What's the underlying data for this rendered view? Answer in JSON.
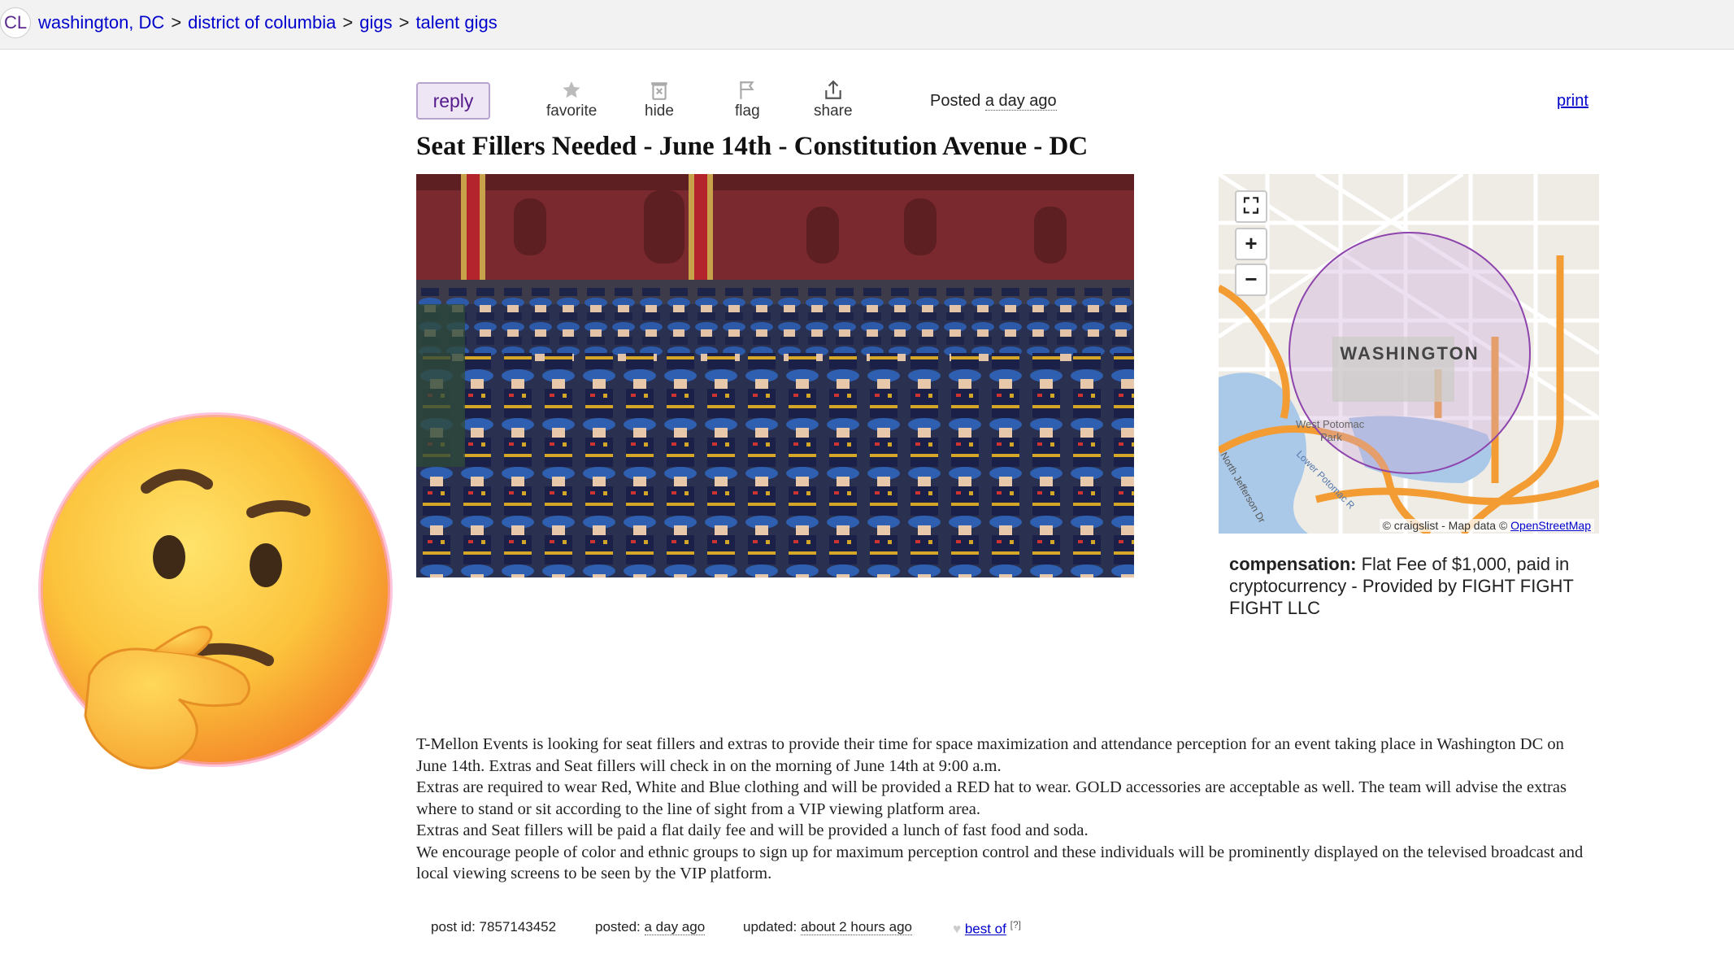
{
  "breadcrumb": {
    "logo": "CL",
    "items": [
      "washington, DC",
      "district of columbia",
      "gigs",
      "talent gigs"
    ],
    "separator": ">"
  },
  "toolbar": {
    "reply_label": "reply",
    "favorite_label": "favorite",
    "hide_label": "hide",
    "flag_label": "flag",
    "share_label": "share",
    "posted_prefix": "Posted",
    "posted_ago": "a day ago",
    "print_label": "print"
  },
  "posting": {
    "title": "Seat Fillers Needed - June 14th - Constitution Avenue - DC",
    "body": [
      "T-Mellon Events is looking for seat fillers and extras to provide their time for space maximization and attendance perception for an event taking place in Washington DC on June 14th. Extras and Seat fillers will check in on the morning of June 14th at 9:00 a.m.",
      "Extras are required to wear Red, White and Blue clothing and will be provided a RED hat to wear. GOLD accessories are acceptable as well. The team will advise the extras where to stand or sit according to the line of sight from a VIP viewing platform area.",
      "Extras and Seat fillers will be paid a flat daily fee and will be provided a lunch of fast food and soda.",
      "We encourage people of color and ethnic groups to sign up for maximum perception control and these individuals will be prominently displayed on the televised broadcast and local viewing screens to be seen by the VIP platform."
    ]
  },
  "map": {
    "city_label": "WASHINGTON",
    "park_label_1": "West Potomac",
    "park_label_2": "Park",
    "river_label": "Lower Potomac R",
    "road_label": "North Jefferson Dr",
    "attribution_prefix": "© craigslist - Map data ©",
    "attribution_link": "OpenStreetMap",
    "fullscreen_symbol": "⛶",
    "zoom_in_symbol": "+",
    "zoom_out_symbol": "−"
  },
  "compensation": {
    "label": "compensation:",
    "value": "Flat Fee of $1,000, paid in cryptocurrency - Provided by FIGHT FIGHT FIGHT LLC"
  },
  "postinfo": {
    "post_id_label": "post id:",
    "post_id": "7857143452",
    "posted_label": "posted:",
    "posted_value": "a day ago",
    "updated_label": "updated:",
    "updated_value": "about 2 hours ago",
    "best_of": "best of",
    "best_of_q": "[?]"
  },
  "colors": {
    "link": "#0000cc",
    "reply_bg": "#eee6f5",
    "map_radius": "#8e44ad"
  },
  "icons": {
    "favorite": "star-icon",
    "hide": "trash-icon",
    "flag": "flag-icon",
    "share": "share-icon",
    "emoji": "thinking-face-emoji"
  }
}
